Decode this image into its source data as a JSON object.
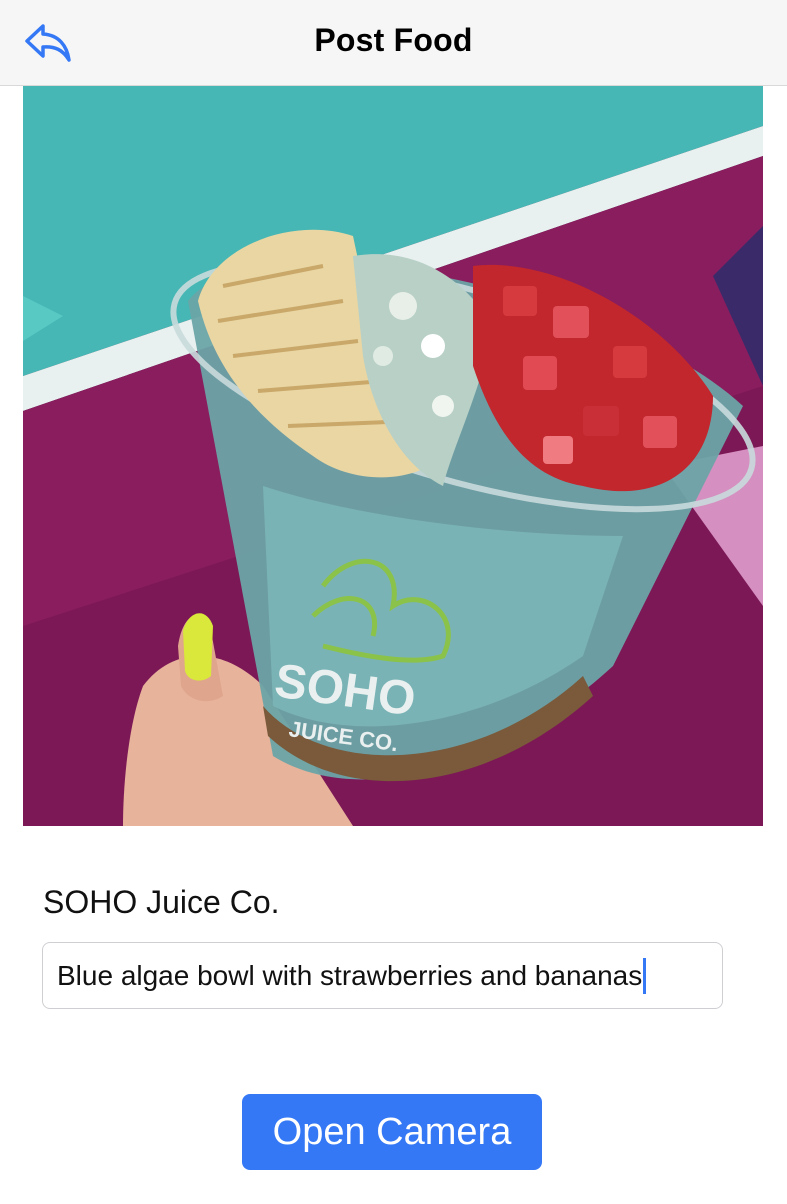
{
  "navbar": {
    "title": "Post Food",
    "back_icon": "reply-arrow-icon"
  },
  "post": {
    "place_name": "SOHO Juice Co.",
    "description_value": "Blue algae bowl with strawberries and bananas",
    "photo_logo_text": "SOHO",
    "photo_logo_subtext": "JUICE CO."
  },
  "actions": {
    "open_camera_label": "Open Camera"
  },
  "colors": {
    "accent": "#3478f6",
    "navbar_bg": "#f6f6f6"
  }
}
